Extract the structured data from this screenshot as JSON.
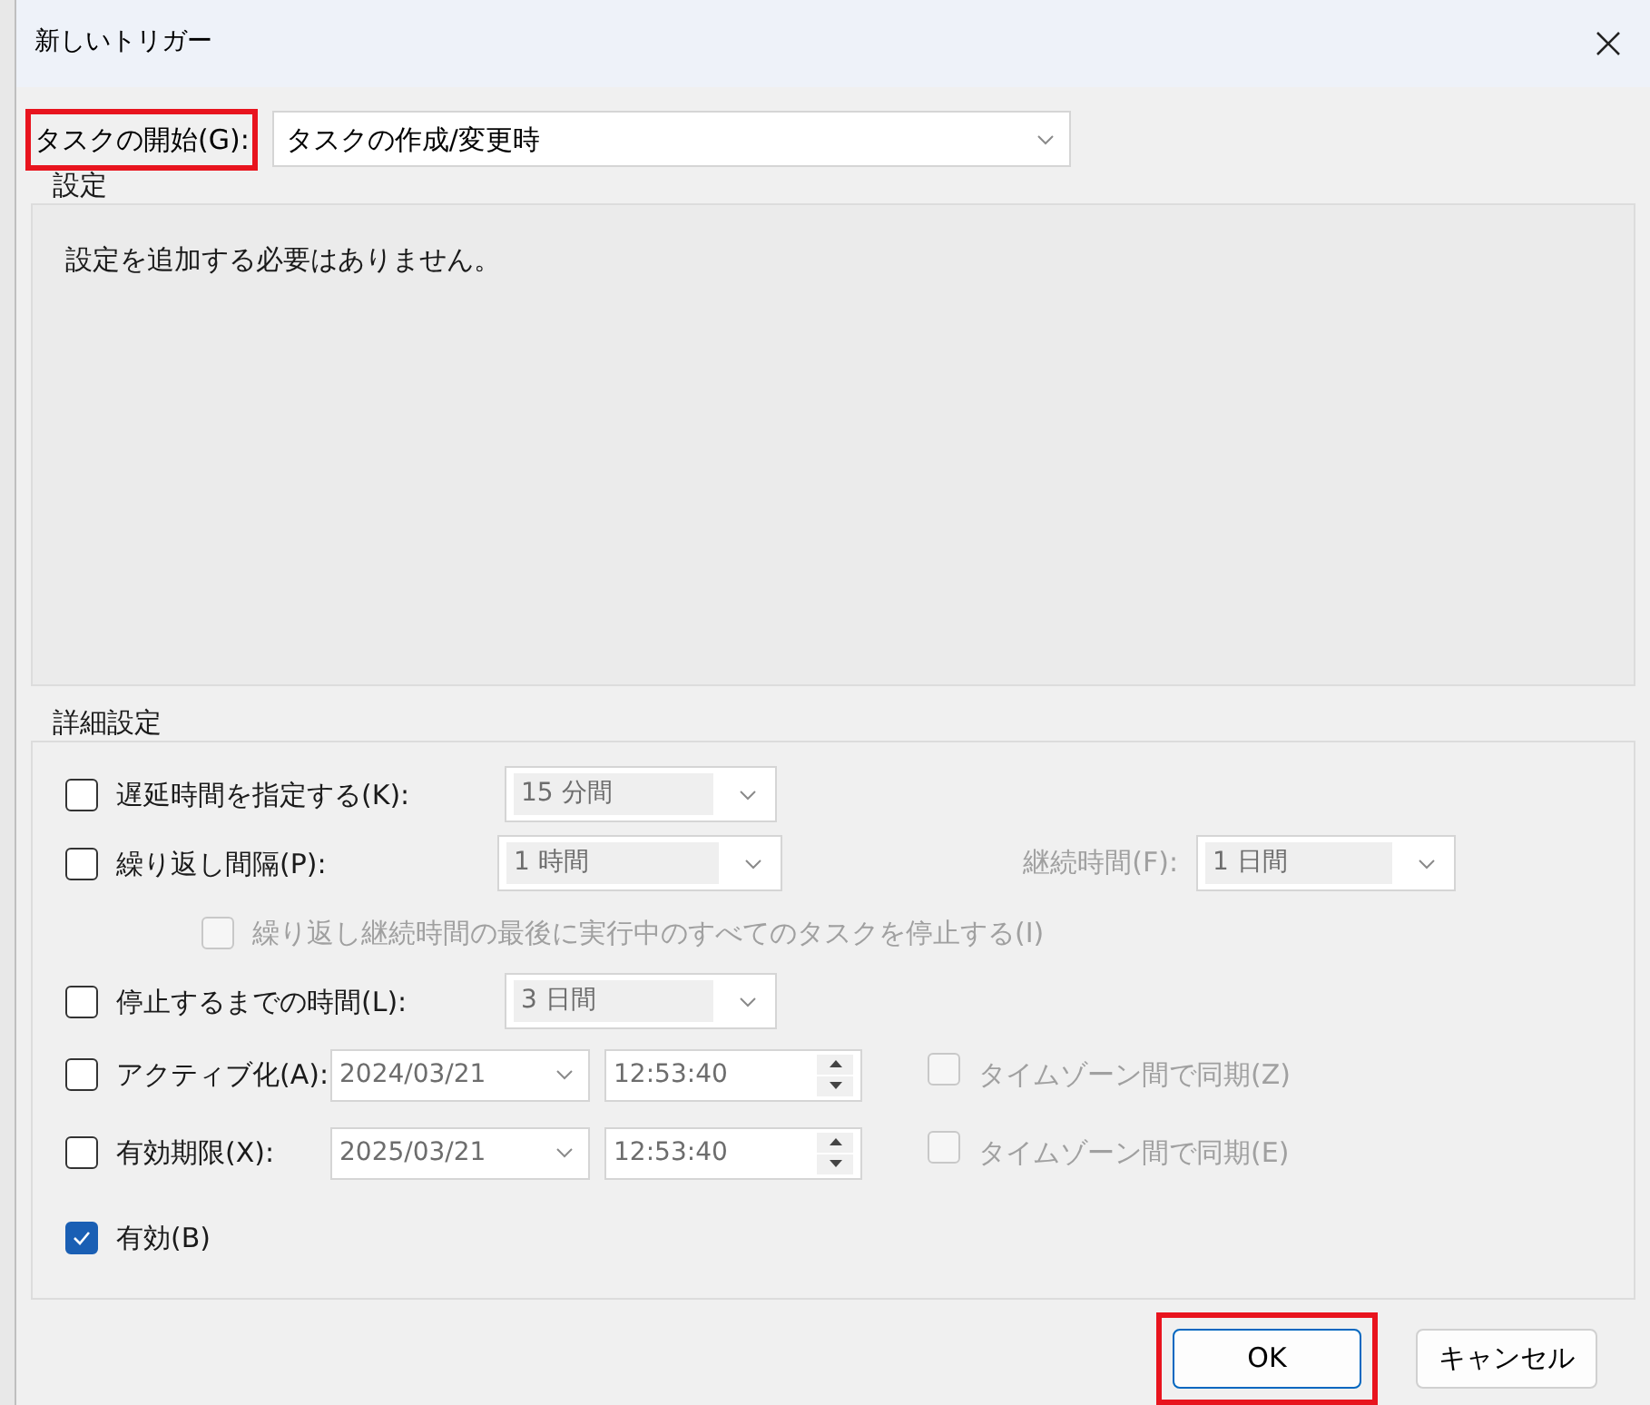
{
  "window": {
    "title": "新しいトリガー"
  },
  "start": {
    "label": "タスクの開始(G):",
    "value": "タスクの作成/変更時",
    "highlighted": true
  },
  "settings": {
    "title": "設定",
    "message": "設定を追加する必要はありません。"
  },
  "advanced": {
    "title": "詳細設定",
    "rows": [
      {
        "kind": "combo",
        "checked": false,
        "label": "遅延時間を指定する(K):",
        "value": "15 分間"
      },
      {
        "kind": "repeat",
        "checked": false,
        "label": "繰り返し間隔(P):",
        "value": "1 時間",
        "duration_label": "継続時間(F):",
        "duration_value": "1 日間"
      },
      {
        "kind": "sub_check",
        "checked": false,
        "label": "繰り返し継続時間の最後に実行中のすべてのタスクを停止する(I)"
      },
      {
        "kind": "combo",
        "checked": false,
        "label": "停止するまでの時間(L):",
        "value": "3 日間"
      },
      {
        "kind": "datetime",
        "checked": false,
        "label": "アクティブ化(A):",
        "date": "2024/03/21",
        "time": "12:53:40",
        "sync_label": "タイムゾーン間で同期(Z)",
        "sync_checked": false
      },
      {
        "kind": "datetime",
        "checked": false,
        "label": "有効期限(X):",
        "date": "2025/03/21",
        "time": "12:53:40",
        "sync_label": "タイムゾーン間で同期(E)",
        "sync_checked": false
      },
      {
        "kind": "check",
        "checked": true,
        "label": "有効(B)"
      }
    ]
  },
  "buttons": [
    {
      "label": "OK",
      "highlighted": true
    },
    {
      "label": "キャンセル",
      "highlighted": false
    }
  ]
}
